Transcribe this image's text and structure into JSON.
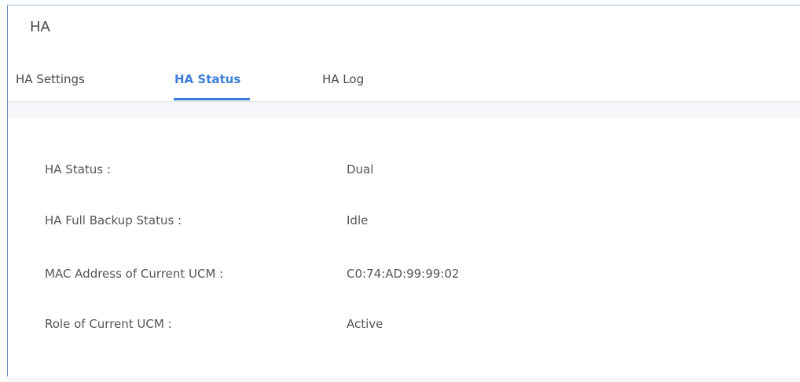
{
  "page": {
    "title": "HA"
  },
  "tabs": [
    {
      "label": "HA Settings",
      "active": false
    },
    {
      "label": "HA Status",
      "active": true
    },
    {
      "label": "HA Log",
      "active": false
    }
  ],
  "status": {
    "rows": [
      {
        "label": "HA Status :",
        "value": "Dual"
      },
      {
        "label": "HA Full Backup Status :",
        "value": "Idle"
      },
      {
        "label": "MAC Address of Current UCM :",
        "value": "C0:74:AD:99:99:02"
      },
      {
        "label": "Role of Current UCM :",
        "value": "Active"
      }
    ]
  },
  "colors": {
    "accent": "#3c7ed8",
    "text": "#555555",
    "panel_bg": "#f4f6f9"
  }
}
